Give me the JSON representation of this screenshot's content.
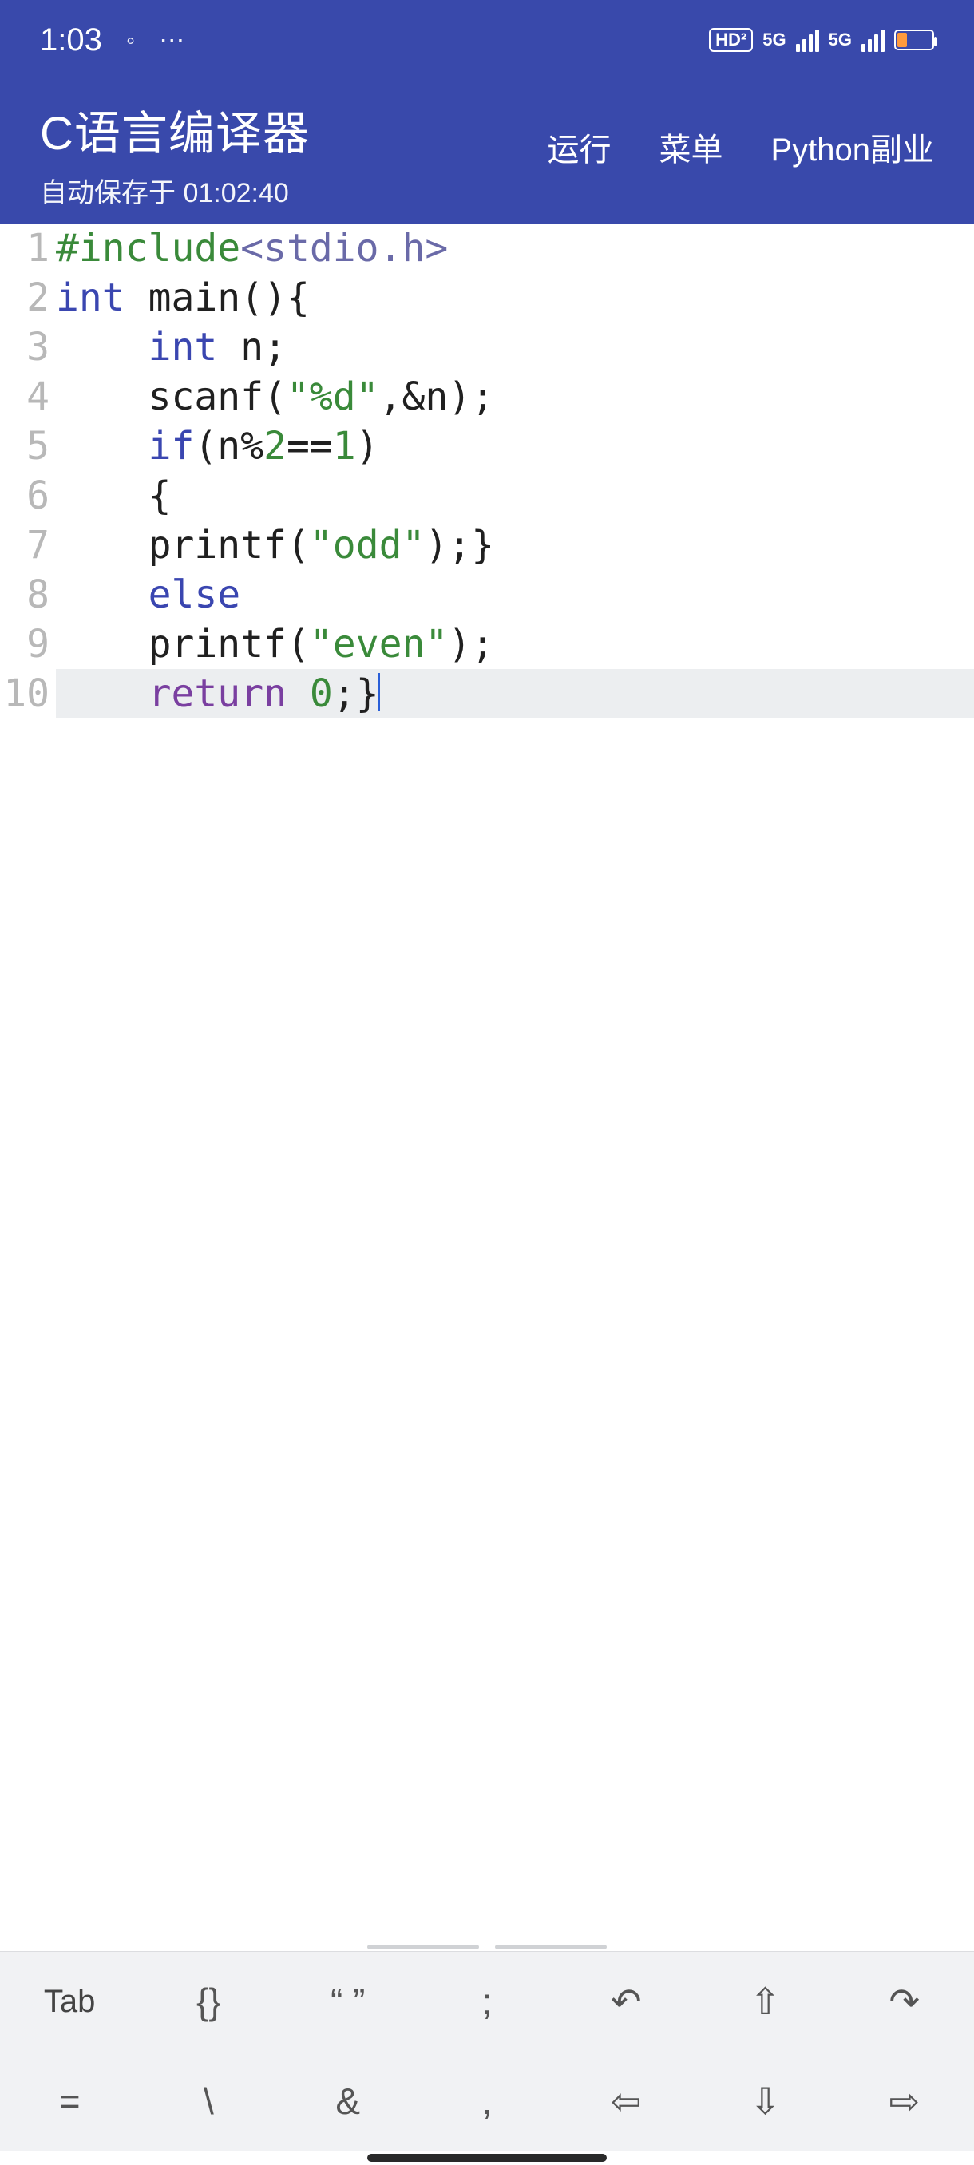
{
  "status": {
    "time": "1:03",
    "hd_badge": "HD²",
    "signal1_label": "5G",
    "signal2_label": "5G"
  },
  "header": {
    "title": "C语言编译器",
    "subtitle": "自动保存于 01:02:40",
    "actions": {
      "run": "运行",
      "menu": "菜单",
      "python": "Python副业"
    }
  },
  "code": {
    "lines": [
      {
        "n": "1",
        "tokens": [
          [
            "pre",
            "#include"
          ],
          [
            "inc",
            "<stdio.h>"
          ]
        ]
      },
      {
        "n": "2",
        "tokens": [
          [
            "kw",
            "int"
          ],
          [
            "pun",
            " "
          ],
          [
            "fn",
            "main"
          ],
          [
            "pun",
            "(){"
          ]
        ]
      },
      {
        "n": "3",
        "tokens": [
          [
            "pun",
            "    "
          ],
          [
            "kw",
            "int"
          ],
          [
            "pun",
            " n;"
          ]
        ]
      },
      {
        "n": "4",
        "tokens": [
          [
            "pun",
            "    "
          ],
          [
            "fn",
            "scanf"
          ],
          [
            "pun",
            "("
          ],
          [
            "str",
            "\"%d\""
          ],
          [
            "pun",
            ",&n);"
          ]
        ]
      },
      {
        "n": "5",
        "tokens": [
          [
            "pun",
            "    "
          ],
          [
            "kw",
            "if"
          ],
          [
            "pun",
            "(n%"
          ],
          [
            "num",
            "2"
          ],
          [
            "pun",
            "=="
          ],
          [
            "num",
            "1"
          ],
          [
            "pun",
            ")"
          ]
        ]
      },
      {
        "n": "6",
        "tokens": [
          [
            "pun",
            "    {"
          ]
        ]
      },
      {
        "n": "7",
        "tokens": [
          [
            "pun",
            "    "
          ],
          [
            "fn",
            "printf"
          ],
          [
            "pun",
            "("
          ],
          [
            "str",
            "\"odd\""
          ],
          [
            "pun",
            ");}"
          ]
        ]
      },
      {
        "n": "8",
        "tokens": [
          [
            "pun",
            "    "
          ],
          [
            "kw",
            "else"
          ]
        ]
      },
      {
        "n": "9",
        "tokens": [
          [
            "pun",
            "    "
          ],
          [
            "fn",
            "printf"
          ],
          [
            "pun",
            "("
          ],
          [
            "str",
            "\"even\""
          ],
          [
            "pun",
            ");"
          ]
        ]
      },
      {
        "n": "10",
        "tokens": [
          [
            "pun",
            "    "
          ],
          [
            "ret",
            "return"
          ],
          [
            "pun",
            " "
          ],
          [
            "num",
            "0"
          ],
          [
            "pun",
            ";}"
          ]
        ],
        "cursor": true,
        "current": true
      }
    ]
  },
  "toolbar": {
    "row1": [
      "Tab",
      "{}",
      "“ ”",
      ";",
      "↶",
      "⇧",
      "↷"
    ],
    "row2": [
      "=",
      "\\",
      "&",
      ",",
      "⇦",
      "⇩",
      "⇨"
    ]
  }
}
